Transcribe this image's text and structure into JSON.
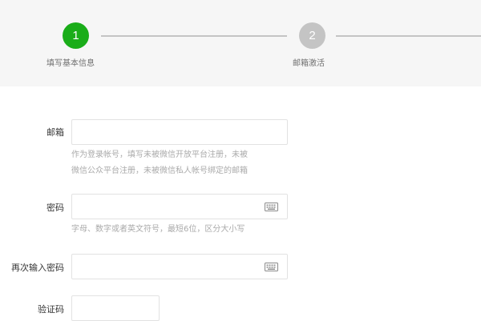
{
  "colors": {
    "step_active": "#1aad19",
    "step_inactive": "#c4c4c4",
    "step_line": "#c4c4c4",
    "input_border": "#e2e2e2",
    "hint_text": "#aaaaaa"
  },
  "stepper": {
    "steps": [
      {
        "number": "1",
        "label": "填写基本信息",
        "state": "active"
      },
      {
        "number": "2",
        "label": "邮箱激活",
        "state": "inactive"
      }
    ]
  },
  "form": {
    "email": {
      "label": "邮箱",
      "value": "",
      "hint_lines": [
        "作为登录帐号，填写未被微信开放平台注册，未被",
        "微信公众平台注册，未被微信私人帐号绑定的邮箱"
      ]
    },
    "password": {
      "label": "密码",
      "value": "",
      "icon": "keyboard-icon",
      "hint": "字母、数字或者英文符号，最短6位，区分大小写"
    },
    "confirm_password": {
      "label": "再次输入密码",
      "value": "",
      "icon": "keyboard-icon"
    },
    "captcha": {
      "label": "验证码",
      "value": ""
    }
  }
}
